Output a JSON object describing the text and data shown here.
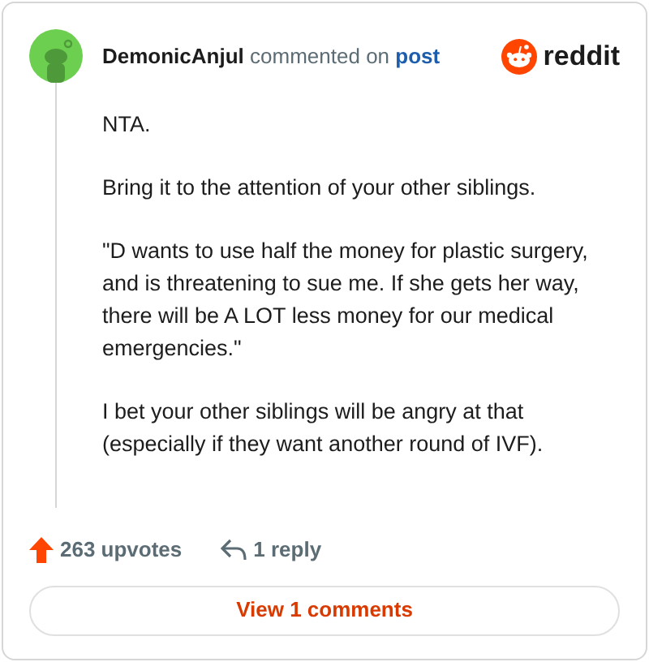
{
  "comment": {
    "author": "DemonicAnjul",
    "action": "commented on",
    "target": "post"
  },
  "brand": "reddit",
  "paragraphs": [
    "NTA.",
    "Bring it to the attention of your other siblings.",
    "\"D wants to use half the money for plastic surgery, and is threatening to sue me. If she gets her way, there will be A LOT less money for our medical emergencies.\"",
    "I bet your other siblings will be angry at that (especially if they want another round of IVF)."
  ],
  "upvotes": "263 upvotes",
  "replies": "1 reply",
  "view_button": "View 1 comments"
}
